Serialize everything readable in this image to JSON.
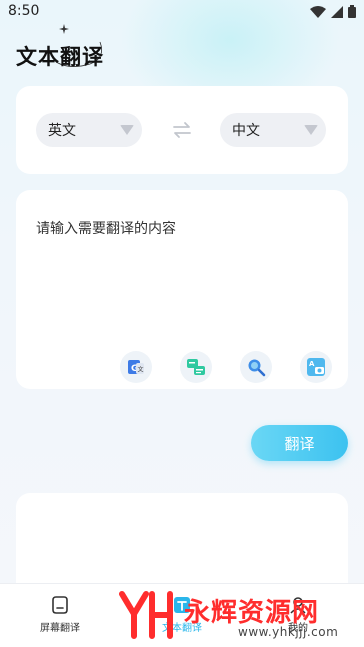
{
  "status_bar": {
    "time": "8:50",
    "icons": [
      "wifi-icon",
      "signal-icon",
      "battery-icon"
    ]
  },
  "header": {
    "title": "文本翻译"
  },
  "language": {
    "source": "英文",
    "target": "中文"
  },
  "input": {
    "placeholder": "请输入需要翻译的内容",
    "tools": [
      "google-translate-icon",
      "text-compare-icon",
      "search-icon",
      "image-translate-icon"
    ]
  },
  "actions": {
    "translate_label": "翻译"
  },
  "bottom_nav": {
    "items": [
      {
        "label": "屏幕翻译",
        "icon": "screen-icon"
      },
      {
        "label": "文本翻译",
        "icon": "text-icon",
        "active": true
      },
      {
        "label": "我的",
        "icon": "user-icon"
      }
    ]
  },
  "watermark": {
    "name": "永辉资源网",
    "url": "www.yhkjjj.com"
  },
  "colors": {
    "accent": "#3cc2f0",
    "background": "#eef5fa",
    "card": "#ffffff",
    "watermark_red": "#ff2d2d"
  }
}
